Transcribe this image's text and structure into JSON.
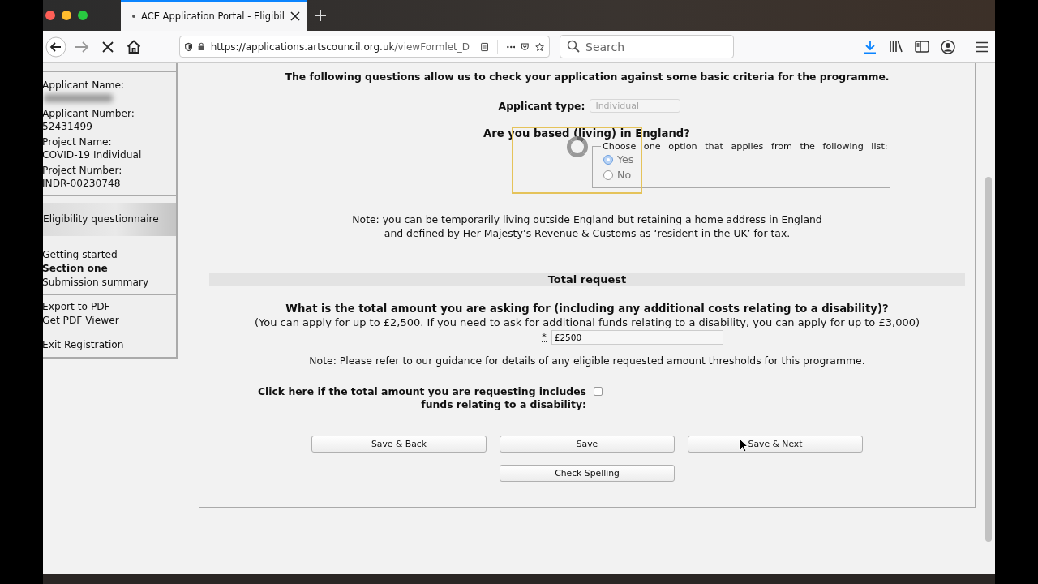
{
  "browser": {
    "tab_title": "ACE Application Portal - Eligibil",
    "url_host": "https://applications.artscouncil.org.uk",
    "url_path": "/viewFormlet_D",
    "search": {
      "placeholder": "Search"
    },
    "loading": true
  },
  "sidebar": {
    "details": [
      {
        "label": "Applicant Name:",
        "blurred": true
      },
      {
        "label": "Applicant Number:",
        "value": "52431499"
      },
      {
        "label": "Project Name:",
        "value": "COVID-19 Individual"
      },
      {
        "label": "Project Number:",
        "value": "INDR-00230748"
      }
    ],
    "current_page": {
      "label": "Eligibility questionnaire",
      "selected": true
    },
    "sections": [
      {
        "label": "Getting started",
        "selected": false
      },
      {
        "label": "Section one",
        "selected": true
      },
      {
        "label": "Submission summary",
        "selected": false
      }
    ],
    "actions": [
      "Export to PDF",
      "Get PDF Viewer"
    ],
    "exit": "Exit Registration"
  },
  "form": {
    "intro": "The following questions allow us to check your application against some basic criteria for the programme.",
    "applicant_type": {
      "label": "Applicant type:",
      "value": "Individual",
      "disabled": true
    },
    "question": {
      "text": "Are you based (living) in England?",
      "legend": "Choose one option that applies from the following list:",
      "options": [
        {
          "label": "Yes",
          "selected": true
        },
        {
          "label": "No",
          "selected": false
        }
      ],
      "disabled": true,
      "note": "Note: you can be temporarily living outside England but retaining a home address in England and defined by Her Majesty’s Revenue & Customs as ‘resident in the UK’ for tax."
    },
    "loading_overlay": true,
    "section_heading": "Total request",
    "amount": {
      "question": "What is the total amount you are asking for (including any additional costs relating to a disability)?",
      "hint": "(You can apply for up to £2,500. If you need to ask for additional funds relating to a disability, you can apply for up to £3,000)",
      "required_mark": "*",
      "value": "£2500",
      "note": "Note: Please refer to our guidance for details of any eligible requested amount thresholds for this programme."
    },
    "disability": {
      "label": "Click here if the total amount you are requesting includes funds relating to a disability:",
      "checked": false
    },
    "buttons": [
      "Save & Back",
      "Save",
      "Save & Next"
    ],
    "check_spelling": "Check Spelling"
  }
}
